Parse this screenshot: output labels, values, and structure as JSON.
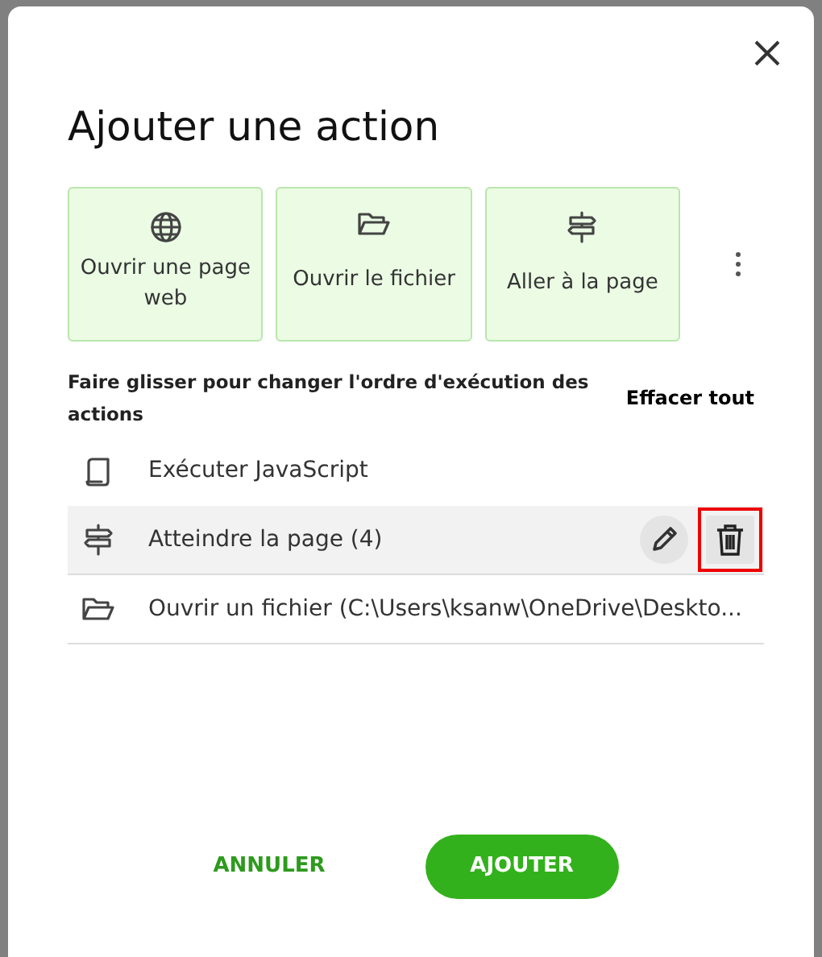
{
  "dialog": {
    "title": "Ajouter une action"
  },
  "quick_actions": [
    {
      "kind": "web",
      "label": "Ouvrir une page web"
    },
    {
      "kind": "file",
      "label": "Ouvrir le fichier"
    },
    {
      "kind": "page",
      "label": "Aller à la page"
    }
  ],
  "hint": "Faire glisser pour changer l'ordre d'exécution des actions",
  "clear_all": "Effacer tout",
  "actions": [
    {
      "kind": "script",
      "label": "Exécuter JavaScript",
      "selected": false,
      "delete_highlighted": false
    },
    {
      "kind": "page",
      "label": "Atteindre la page (4)",
      "selected": true,
      "delete_highlighted": true
    },
    {
      "kind": "file",
      "label": "Ouvrir un fichier (C:\\Users\\ksanw\\OneDrive\\Deskto...",
      "selected": false,
      "delete_highlighted": false
    }
  ],
  "buttons": {
    "cancel": "ANNULER",
    "confirm": "AJOUTER"
  }
}
